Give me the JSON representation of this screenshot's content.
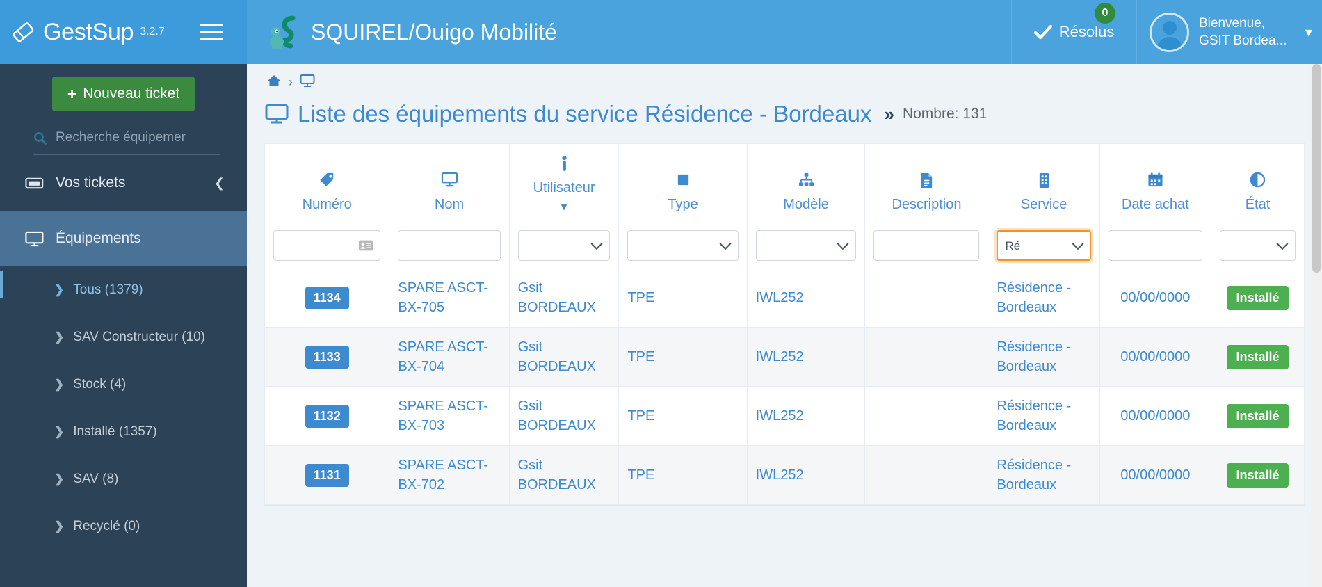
{
  "topbar": {
    "brand_name": "GestSup",
    "brand_version": "3.2.7",
    "logo_icon": "diamond-tag-icon",
    "menu_icon": "hamburger-menu-icon",
    "app_logo_icon": "squirrel-logo-icon",
    "app_title": "SQUIREL/Ouigo Mobilité",
    "resolved_label": "Résolus",
    "resolved_icon": "check-icon",
    "resolved_count": "0",
    "user_greeting": "Bienvenue,",
    "user_name": "GSIT Bordea...",
    "avatar_icon": "user-avatar-icon",
    "user_caret_icon": "chevron-down-icon",
    "brand_color": "#4ba3dd",
    "badge_color": "#2f8b3d"
  },
  "sidebar": {
    "new_ticket_label": "Nouveau ticket",
    "new_ticket_icon": "plus-icon",
    "new_ticket_color": "#3c8a3f",
    "search_placeholder": "Recherche équipemer",
    "search_value": "",
    "search_icon": "search-icon",
    "nav": [
      {
        "label": "Vos tickets",
        "icon": "ticket-icon",
        "caret": "chevron-left-icon",
        "active": false
      },
      {
        "label": "Équipements",
        "icon": "monitor-icon",
        "active": true
      }
    ],
    "sub_items": [
      {
        "label": "Tous (1379)",
        "icon": "chevron-right-icon",
        "current": true
      },
      {
        "label": "SAV Constructeur (10)",
        "icon": "chevron-right-icon",
        "current": false
      },
      {
        "label": "Stock (4)",
        "icon": "chevron-right-icon",
        "current": false
      },
      {
        "label": "Installé (1357)",
        "icon": "chevron-right-icon",
        "current": false
      },
      {
        "label": "SAV (8)",
        "icon": "chevron-right-icon",
        "current": false
      },
      {
        "label": "Recyclé (0)",
        "icon": "chevron-right-icon",
        "current": false
      }
    ]
  },
  "breadcrumb": {
    "home_icon": "home-icon",
    "separator": "›",
    "current_icon": "monitor-icon"
  },
  "page": {
    "title_icon": "monitor-icon",
    "title": "Liste des équipements du service Résidence - Bordeaux",
    "chevrons_icon": "double-chevron-right-icon",
    "count_label": "Nombre: 131"
  },
  "table": {
    "columns": [
      {
        "key": "numero",
        "label": "Numéro",
        "icon": "tag-icon",
        "sort": ""
      },
      {
        "key": "nom",
        "label": "Nom",
        "icon": "monitor-icon",
        "sort": ""
      },
      {
        "key": "utilisateur",
        "label": "Utilisateur",
        "icon": "person-icon",
        "sort": "▾"
      },
      {
        "key": "type",
        "label": "Type",
        "icon": "square-icon",
        "sort": ""
      },
      {
        "key": "modele",
        "label": "Modèle",
        "icon": "sitemap-icon",
        "sort": ""
      },
      {
        "key": "description",
        "label": "Description",
        "icon": "document-icon",
        "sort": ""
      },
      {
        "key": "service",
        "label": "Service",
        "icon": "building-icon",
        "sort": ""
      },
      {
        "key": "date_achat",
        "label": "Date achat",
        "icon": "calendar-icon",
        "sort": ""
      },
      {
        "key": "etat",
        "label": "État",
        "icon": "half-circle-icon",
        "sort": ""
      }
    ],
    "filters": [
      {
        "key": "numero",
        "type": "text",
        "value": "",
        "placeholder": "",
        "icon": "id-card-icon"
      },
      {
        "key": "nom",
        "type": "text",
        "value": "",
        "placeholder": ""
      },
      {
        "key": "utilisateur",
        "type": "select",
        "value": ""
      },
      {
        "key": "type",
        "type": "select",
        "value": ""
      },
      {
        "key": "modele",
        "type": "select",
        "value": ""
      },
      {
        "key": "description",
        "type": "text",
        "value": "",
        "placeholder": ""
      },
      {
        "key": "service",
        "type": "select",
        "value": "Ré",
        "focused": true
      },
      {
        "key": "date_achat",
        "type": "text",
        "value": "",
        "placeholder": ""
      },
      {
        "key": "etat",
        "type": "select",
        "value": ""
      }
    ],
    "rows": [
      {
        "numero": "1134",
        "nom": "SPARE ASCT-BX-705",
        "utilisateur": "Gsit BORDEAUX",
        "type": "TPE",
        "modele": "IWL252",
        "description": "",
        "service": "Résidence - Bordeaux",
        "date_achat": "00/00/0000",
        "etat": "Installé"
      },
      {
        "numero": "1133",
        "nom": "SPARE ASCT-BX-704",
        "utilisateur": "Gsit BORDEAUX",
        "type": "TPE",
        "modele": "IWL252",
        "description": "",
        "service": "Résidence - Bordeaux",
        "date_achat": "00/00/0000",
        "etat": "Installé"
      },
      {
        "numero": "1132",
        "nom": "SPARE ASCT-BX-703",
        "utilisateur": "Gsit BORDEAUX",
        "type": "TPE",
        "modele": "IWL252",
        "description": "",
        "service": "Résidence - Bordeaux",
        "date_achat": "00/00/0000",
        "etat": "Installé"
      },
      {
        "numero": "1131",
        "nom": "SPARE ASCT-BX-702",
        "utilisateur": "Gsit BORDEAUX",
        "type": "TPE",
        "modele": "IWL252",
        "description": "",
        "service": "Résidence - Bordeaux",
        "date_achat": "00/00/0000",
        "etat": "Installé"
      }
    ],
    "state_badge_color": "#4caf50",
    "number_badge_color": "#3d8ad0",
    "link_color": "#3d8ad0"
  }
}
